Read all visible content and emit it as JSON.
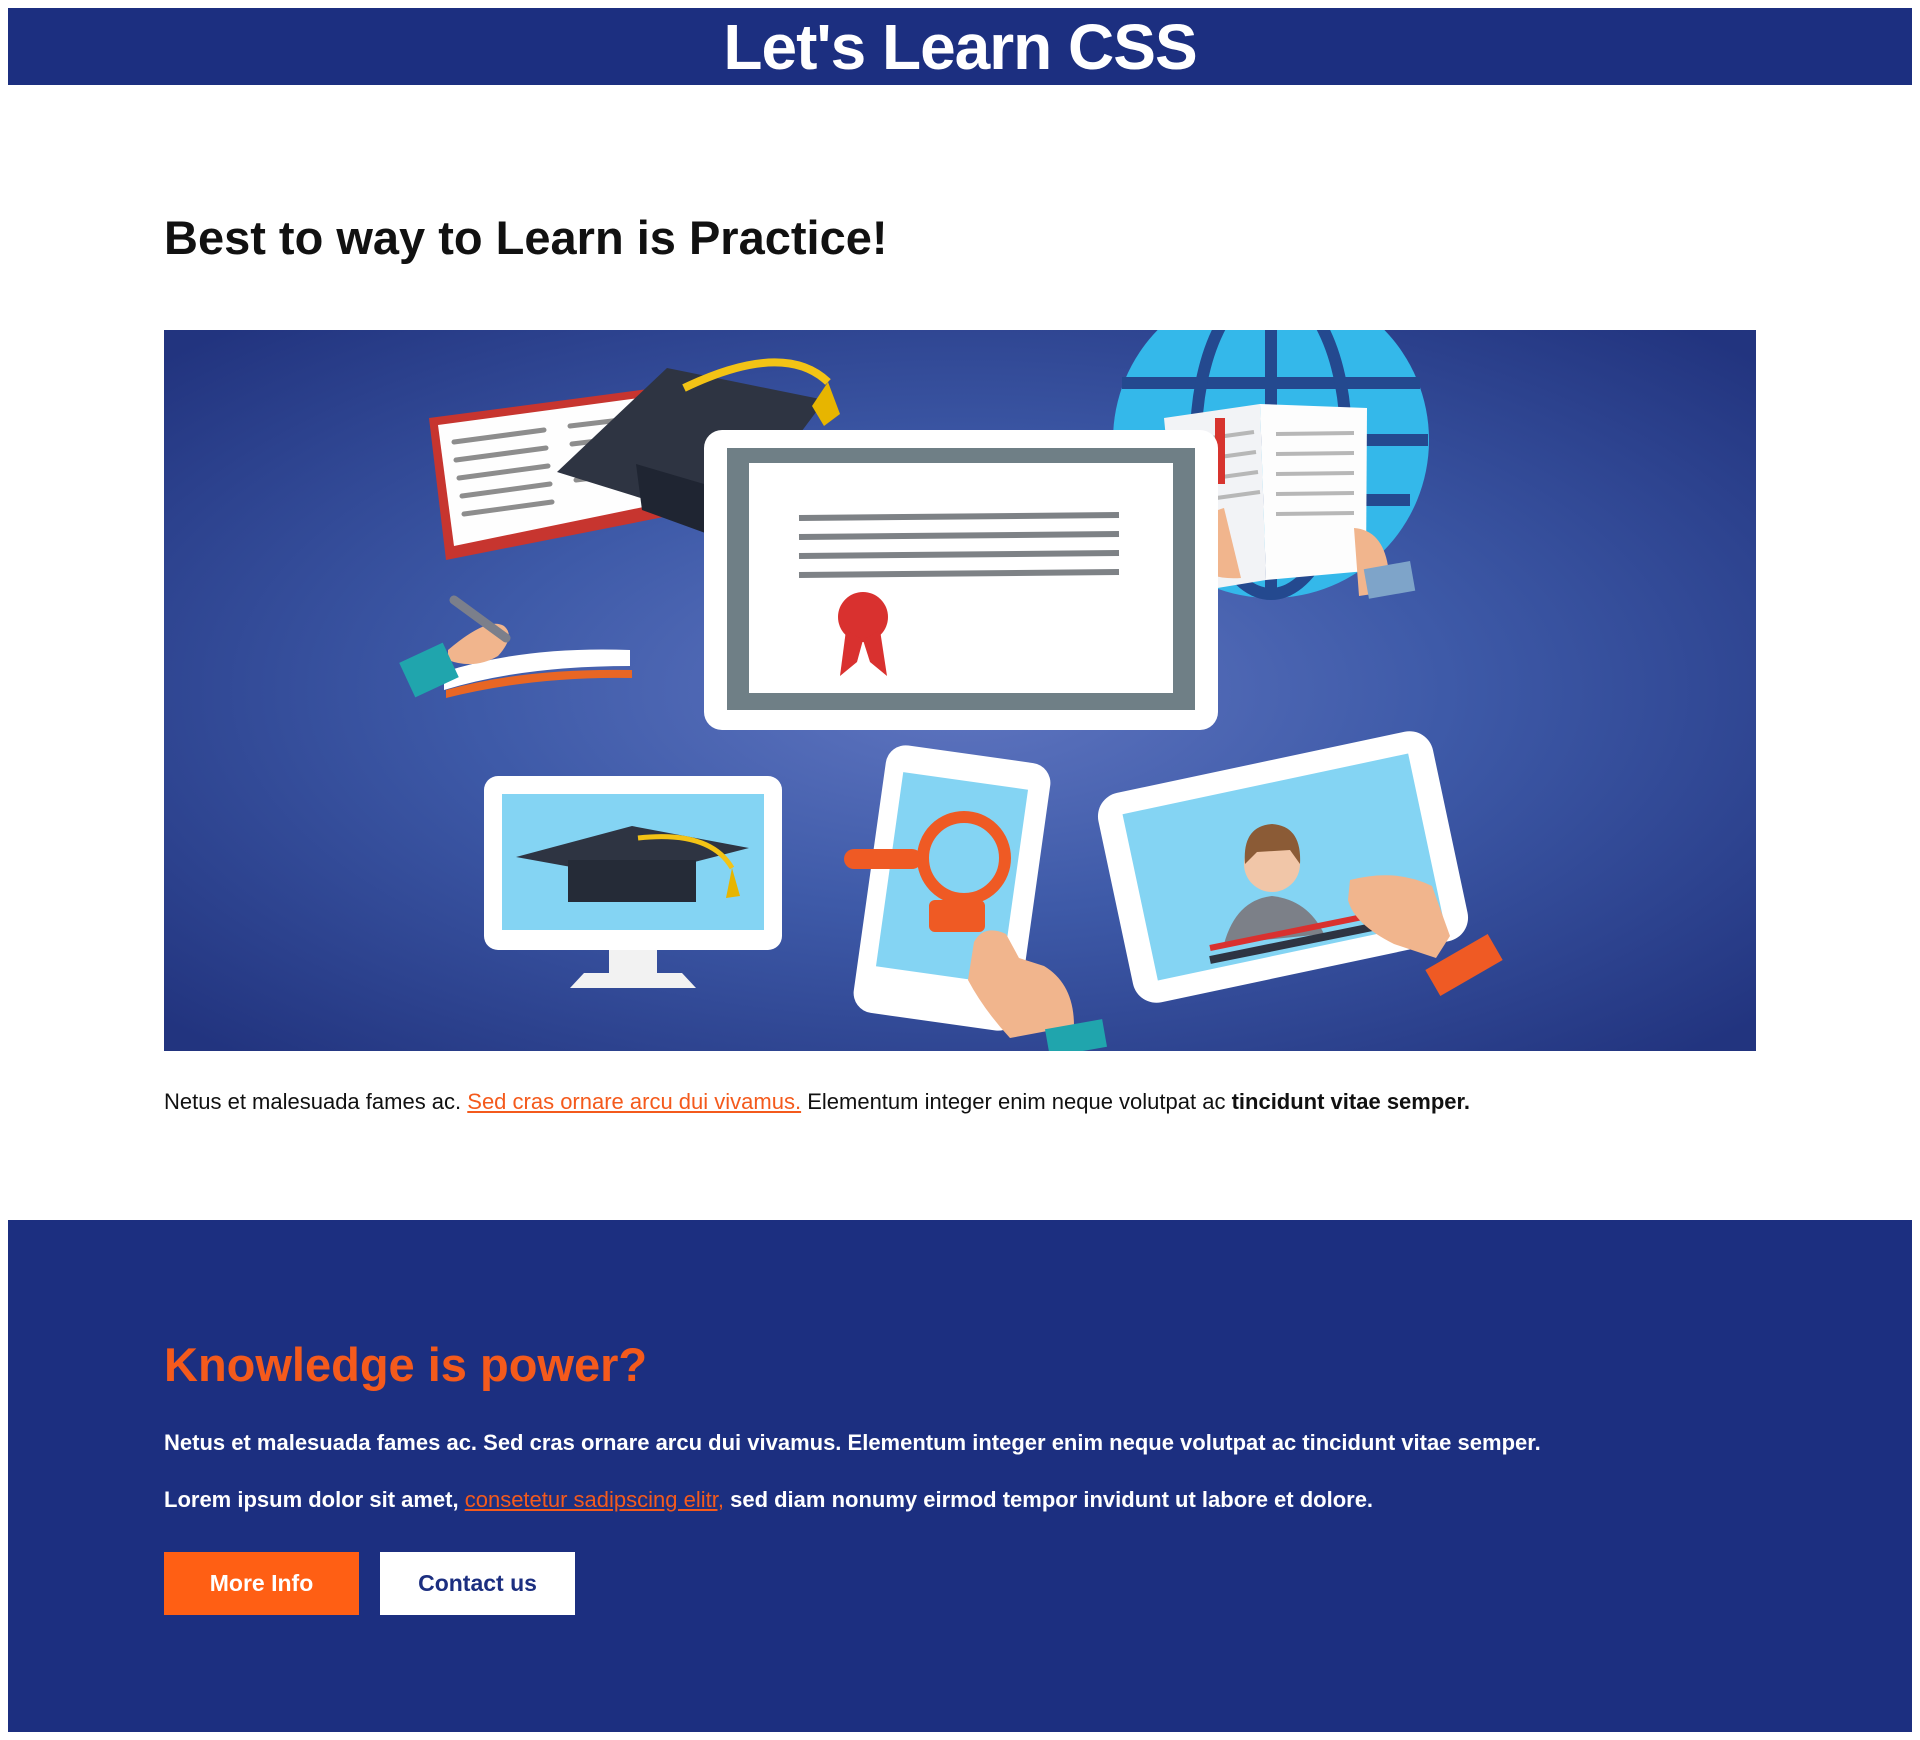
{
  "header": {
    "title": "Let's Learn CSS"
  },
  "intro": {
    "heading": "Best to way to Learn is Practice!",
    "paragraph": {
      "lead": "Netus et malesuada fames ac. ",
      "link": "Sed cras ornare arcu dui vivamus.",
      "middle": " Elementum integer enim neque volutpat ac ",
      "bold": "tincidunt vitae semper."
    }
  },
  "cta": {
    "heading": "Knowledge is power?",
    "paragraph_1": "Netus et malesuada fames ac. Sed cras ornare arcu dui vivamus. Elementum integer enim neque volutpat ac tincidunt vitae semper.",
    "paragraph_2": {
      "lead": "Lorem ipsum dolor sit amet, ",
      "link": "consetetur sadipscing elitr,",
      "tail": " sed diam nonumy eirmod tempor invidunt ut labore et dolore."
    },
    "buttons": {
      "more_info": "More Info",
      "contact": "Contact us"
    }
  },
  "colors": {
    "navy": "#1c2f80",
    "accent_orange": "#ff5f14",
    "link_orange": "#f45a1c",
    "white": "#ffffff"
  },
  "illustration_icons": [
    "open-book-icon",
    "graduation-cap-icon",
    "globe-icon",
    "certificate-screen-icon",
    "pen-hand-icon",
    "monitor-icon",
    "smartphone-search-icon",
    "video-tablet-icon"
  ]
}
